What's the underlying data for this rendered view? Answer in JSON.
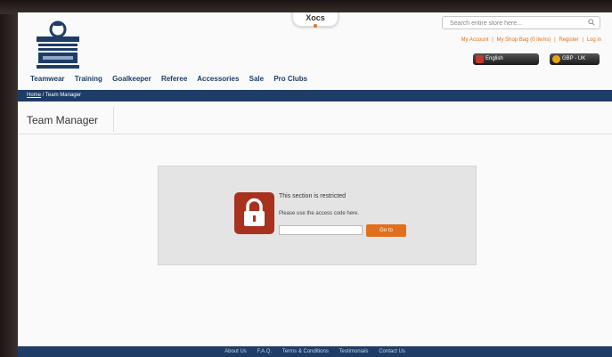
{
  "header": {
    "center_tab_label": "Xocs",
    "search_placeholder": "Search entire store here...",
    "account_links": [
      "My Account",
      "|",
      "My Shop Bag (0 items)",
      "|",
      "Register",
      "|",
      "Log in"
    ],
    "pills": [
      {
        "label": "English",
        "icon": "flag-icon",
        "icon_color": "#c0392b"
      },
      {
        "label": "GBP - UK",
        "icon": "coin-icon",
        "icon_color": "#e8a317"
      }
    ]
  },
  "nav": {
    "items": [
      "Teamwear",
      "Training",
      "Goalkeeper",
      "Referee",
      "Accessories",
      "Sale",
      "Pro Clubs"
    ]
  },
  "breadcrumb": {
    "home": "Home",
    "separator": " / ",
    "current": "Team Manager"
  },
  "page": {
    "title": "Team Manager"
  },
  "restricted": {
    "title": "This section is restricted",
    "subtitle": "Please use the access code here.",
    "code_value": "",
    "button_label": "Go to"
  },
  "footer": {
    "links": [
      "About Us",
      "F.A.Q.",
      "Terms & Conditions",
      "Testimonials",
      "Contact Us"
    ]
  },
  "colors": {
    "navy": "#1e3c66",
    "accent_orange": "#e0701e",
    "lock_red": "#a8321e"
  }
}
